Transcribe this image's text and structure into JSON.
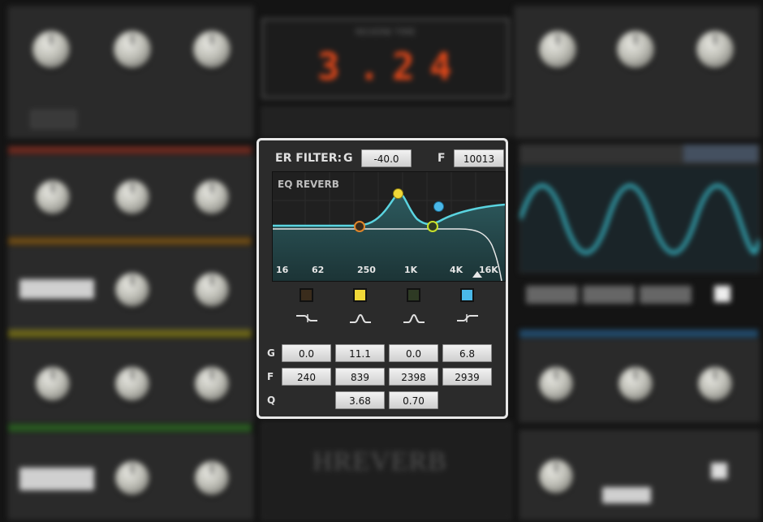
{
  "er_filter": {
    "title": "ER FILTER:",
    "gain_label": "G",
    "gain_value": "-40.0",
    "freq_label": "F",
    "freq_value": "10013"
  },
  "eq": {
    "title": "EQ REVERB",
    "freq_labels": [
      "16",
      "62",
      "250",
      "1K",
      "4K",
      "16K"
    ],
    "bands": [
      {
        "name": "band-1",
        "color": "#3a2c1c",
        "type": "low-shelf",
        "gain": "0.0",
        "freq": "240",
        "q": ""
      },
      {
        "name": "band-2",
        "color": "#f0d838",
        "type": "peak",
        "gain": "11.1",
        "freq": "839",
        "q": "3.68"
      },
      {
        "name": "band-3",
        "color": "#2e3a24",
        "type": "peak",
        "gain": "0.0",
        "freq": "2398",
        "q": "0.70"
      },
      {
        "name": "band-4",
        "color": "#4ab8e8",
        "type": "high-shelf",
        "gain": "6.8",
        "freq": "2939",
        "q": ""
      }
    ],
    "row_labels": {
      "gain": "G",
      "freq": "F",
      "q": "Q"
    }
  },
  "background": {
    "reverb_time": {
      "label": "REVERB TIME",
      "digits": [
        "3",
        ".",
        "2",
        "4"
      ]
    },
    "logo": "HREVERB"
  },
  "colors": {
    "accent_curve": "#5ad4e0",
    "digit": "#e2481a",
    "panel_border": "#e8e8e8"
  }
}
